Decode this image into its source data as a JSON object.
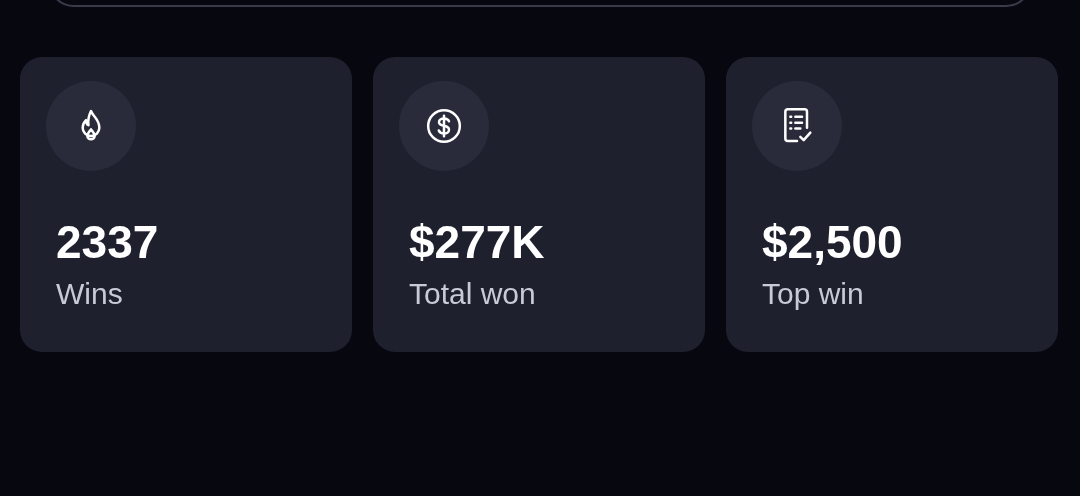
{
  "stats": [
    {
      "kind": "flame",
      "value": "2337",
      "label": "Wins"
    },
    {
      "kind": "dollar",
      "value": "$277K",
      "label": "Total won"
    },
    {
      "kind": "document",
      "value": "$2,500",
      "label": "Top win"
    }
  ]
}
